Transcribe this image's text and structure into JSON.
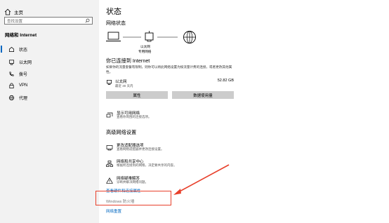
{
  "sidebar": {
    "home_label": "主页",
    "search_placeholder": "查找设置",
    "section_title": "网络和 Internet",
    "items": [
      {
        "label": "状态",
        "icon": "home-status-icon"
      },
      {
        "label": "以太网",
        "icon": "ethernet-icon"
      },
      {
        "label": "拨号",
        "icon": "dialup-icon"
      },
      {
        "label": "VPN",
        "icon": "vpn-icon"
      },
      {
        "label": "代理",
        "icon": "globe-proxy-icon"
      }
    ]
  },
  "main": {
    "title": "状态",
    "network_status_label": "网络状态",
    "diagram": {
      "adapter_name": "以太网",
      "adapter_type": "专用网络"
    },
    "connected_title": "你已连接到 Internet",
    "connected_desc": "如果你的流量套餐有限制，则你可以将此网络设置为按流量计费的连接，或者更改其他属性。",
    "ethernet": {
      "name": "以太网",
      "period": "最近 30 天内",
      "usage": "52.82 GB"
    },
    "buttons": {
      "properties": "属性",
      "data_usage": "数据使用量"
    },
    "show_networks": {
      "title": "显示可用网络",
      "desc": "查看你周围的连接选项。"
    },
    "advanced_title": "高级网络设置",
    "advanced_options": [
      {
        "title": "更改适配器选项",
        "desc": "查看网络适配器并更改连接设置。",
        "icon": "adapter-options-icon"
      },
      {
        "title": "网络和共享中心",
        "desc": "根据所连接到的网络，决定要共享的内容。",
        "icon": "sharing-center-icon"
      },
      {
        "title": "网络疑难解答",
        "desc": "诊断并解决网络问题。",
        "icon": "troubleshoot-warning-icon"
      }
    ],
    "hardware_link": "查看硬件和连接属性",
    "firewall_link": "Windows 防火墙",
    "reset_link": "网络重置"
  },
  "colors": {
    "accent": "#0067c0",
    "sidebar_bg": "#f2f2f2",
    "button_bg": "#cccccc",
    "annotation": "#e8402b"
  }
}
